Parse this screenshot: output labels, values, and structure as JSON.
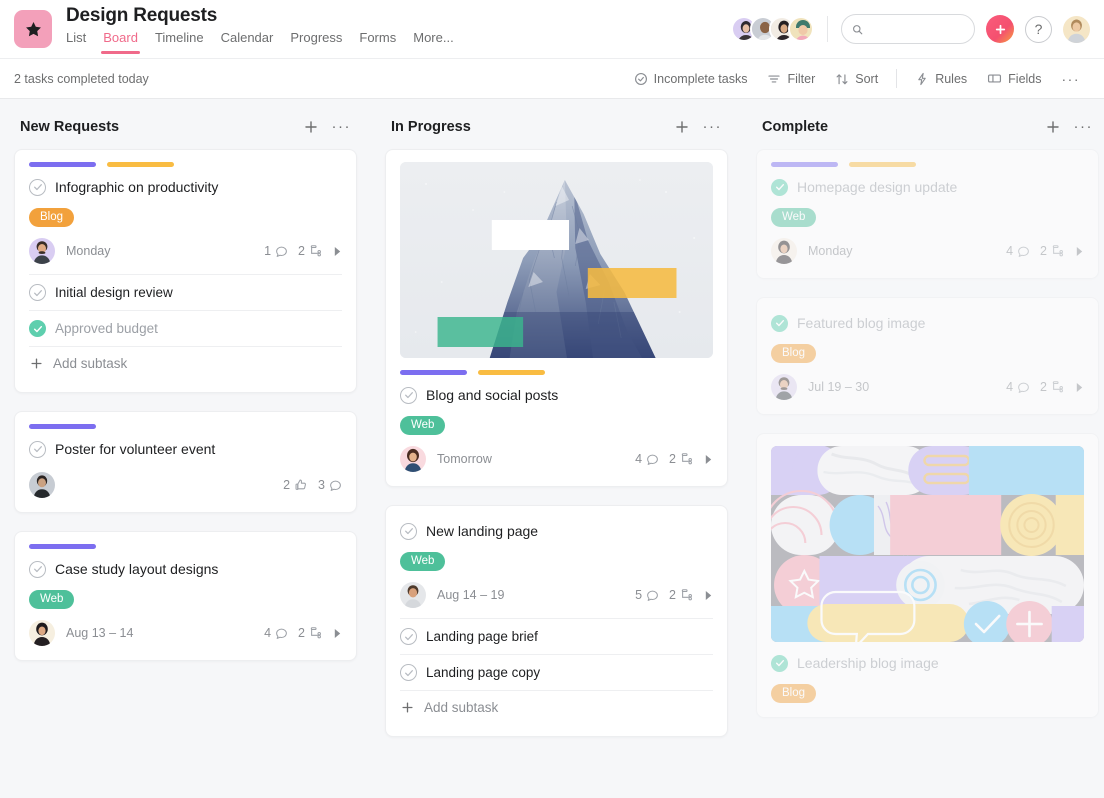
{
  "header": {
    "project_title": "Design Requests",
    "project_icon": "star-icon",
    "tabs": [
      {
        "label": "List",
        "active": false
      },
      {
        "label": "Board",
        "active": true
      },
      {
        "label": "Timeline",
        "active": false
      },
      {
        "label": "Calendar",
        "active": false
      },
      {
        "label": "Progress",
        "active": false
      },
      {
        "label": "Forms",
        "active": false
      },
      {
        "label": "More...",
        "active": false
      }
    ],
    "search": {
      "placeholder": "",
      "value": "",
      "icon": "search-icon"
    },
    "add_button_icon": "plus-icon",
    "help_button_label": "?",
    "member_avatars": 4
  },
  "toolbar": {
    "status_text": "2 tasks completed today",
    "items": [
      {
        "label": "Incomplete tasks",
        "icon": "check-circle-icon"
      },
      {
        "label": "Filter",
        "icon": "filter-icon"
      },
      {
        "label": "Sort",
        "icon": "sort-icon"
      },
      {
        "label": "Rules",
        "icon": "bolt-icon"
      },
      {
        "label": "Fields",
        "icon": "fields-icon"
      },
      {
        "label": "···",
        "icon": "more-icon"
      }
    ]
  },
  "colors": {
    "accent_pink": "#f06a8a",
    "tag_blog": "#f2a13c",
    "tag_web": "#4ec09a",
    "bar_purple": "#7c6ef0",
    "bar_yellow": "#f9bc42",
    "complete_green": "#5ecfae",
    "background": "#f6f7f9"
  },
  "columns": [
    {
      "title": "New Requests",
      "add_icon": "plus-icon",
      "more_icon": "more-icon",
      "cards": [
        {
          "title": "Infographic on productivity",
          "completed": false,
          "bars": [
            "#7c6ef0",
            "#f9bc42"
          ],
          "tag": {
            "label": "Blog",
            "type": "blog"
          },
          "due": "Monday",
          "comments": "1",
          "subtask_count": "2",
          "has_expand": true,
          "subtasks": [
            {
              "label": "Initial design review",
              "completed": false
            },
            {
              "label": "Approved budget",
              "completed": true
            }
          ],
          "add_subtask_label": "Add subtask"
        },
        {
          "title": "Poster for volunteer event",
          "completed": false,
          "bars": [
            "#7c6ef0"
          ],
          "likes": "2",
          "comments": "3"
        },
        {
          "title": "Case study layout designs",
          "completed": false,
          "bars": [
            "#7c6ef0"
          ],
          "tag": {
            "label": "Web",
            "type": "web"
          },
          "due": "Aug 13 – 14",
          "comments": "4",
          "subtask_count": "2",
          "has_expand": true
        }
      ]
    },
    {
      "title": "In Progress",
      "add_icon": "plus-icon",
      "more_icon": "more-icon",
      "cards": [
        {
          "title": "Blog and social posts",
          "completed": false,
          "image": "mountain-photo",
          "bars": [
            "#7c6ef0",
            "#f9bc42"
          ],
          "tag": {
            "label": "Web",
            "type": "web"
          },
          "due": "Tomorrow",
          "comments": "4",
          "subtask_count": "2",
          "has_expand": true
        },
        {
          "title": "New landing page",
          "completed": false,
          "tag": {
            "label": "Web",
            "type": "web"
          },
          "due": "Aug 14 – 19",
          "comments": "5",
          "subtask_count": "2",
          "has_expand": true,
          "subtasks": [
            {
              "label": "Landing page brief",
              "completed": false
            },
            {
              "label": "Landing page copy",
              "completed": false
            }
          ],
          "add_subtask_label": "Add subtask"
        }
      ]
    },
    {
      "title": "Complete",
      "add_icon": "plus-icon",
      "more_icon": "more-icon",
      "cards": [
        {
          "title": "Homepage design update",
          "completed": true,
          "bars": [
            "#7c6ef0",
            "#f9bc42"
          ],
          "tag": {
            "label": "Web",
            "type": "web"
          },
          "due": "Monday",
          "comments": "4",
          "subtask_count": "2",
          "has_expand": true
        },
        {
          "title": "Featured blog image",
          "completed": true,
          "tag": {
            "label": "Blog",
            "type": "blog"
          },
          "due": "Jul 19 – 30",
          "comments": "4",
          "subtask_count": "2",
          "has_expand": true
        },
        {
          "title": "Leadership blog image",
          "completed": true,
          "image": "abstract-shapes",
          "tag": {
            "label": "Blog",
            "type": "blog"
          }
        }
      ]
    }
  ]
}
